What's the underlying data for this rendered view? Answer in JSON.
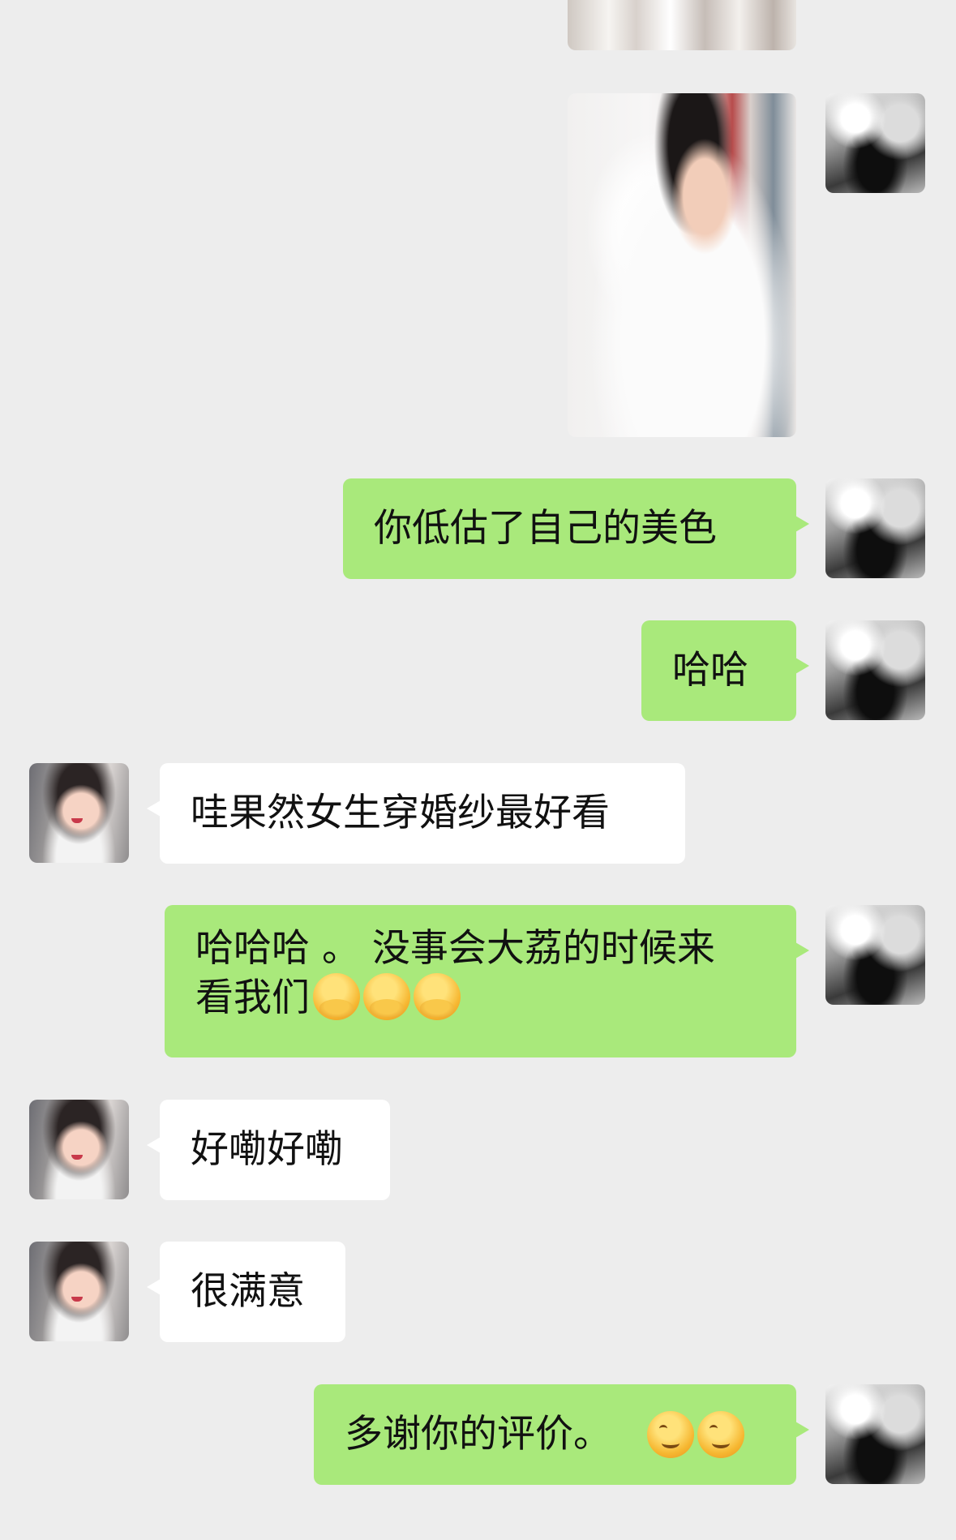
{
  "colors": {
    "background": "#ededed",
    "my_bubble": "#a9e97b",
    "other_bubble": "#ffffff"
  },
  "messages": [
    {
      "sender": "me",
      "type": "image"
    },
    {
      "sender": "me",
      "type": "image"
    },
    {
      "sender": "me",
      "type": "text",
      "text": "你低估了自己的美色"
    },
    {
      "sender": "me",
      "type": "text",
      "text": "哈哈"
    },
    {
      "sender": "other",
      "type": "text",
      "text": "哇果然女生穿婚纱最好看"
    },
    {
      "sender": "me",
      "type": "text",
      "text": "哈哈哈 。 没事会大荔的时候来",
      "text2": "看我们",
      "emojis": [
        "hug-emoji",
        "hug-emoji",
        "hug-emoji"
      ]
    },
    {
      "sender": "other",
      "type": "text",
      "text": "好嘞好嘞"
    },
    {
      "sender": "other",
      "type": "text",
      "text": "很满意"
    },
    {
      "sender": "me",
      "type": "text",
      "text": "多谢你的评价。",
      "emojis": [
        "smile-emoji",
        "smile-emoji"
      ]
    }
  ]
}
